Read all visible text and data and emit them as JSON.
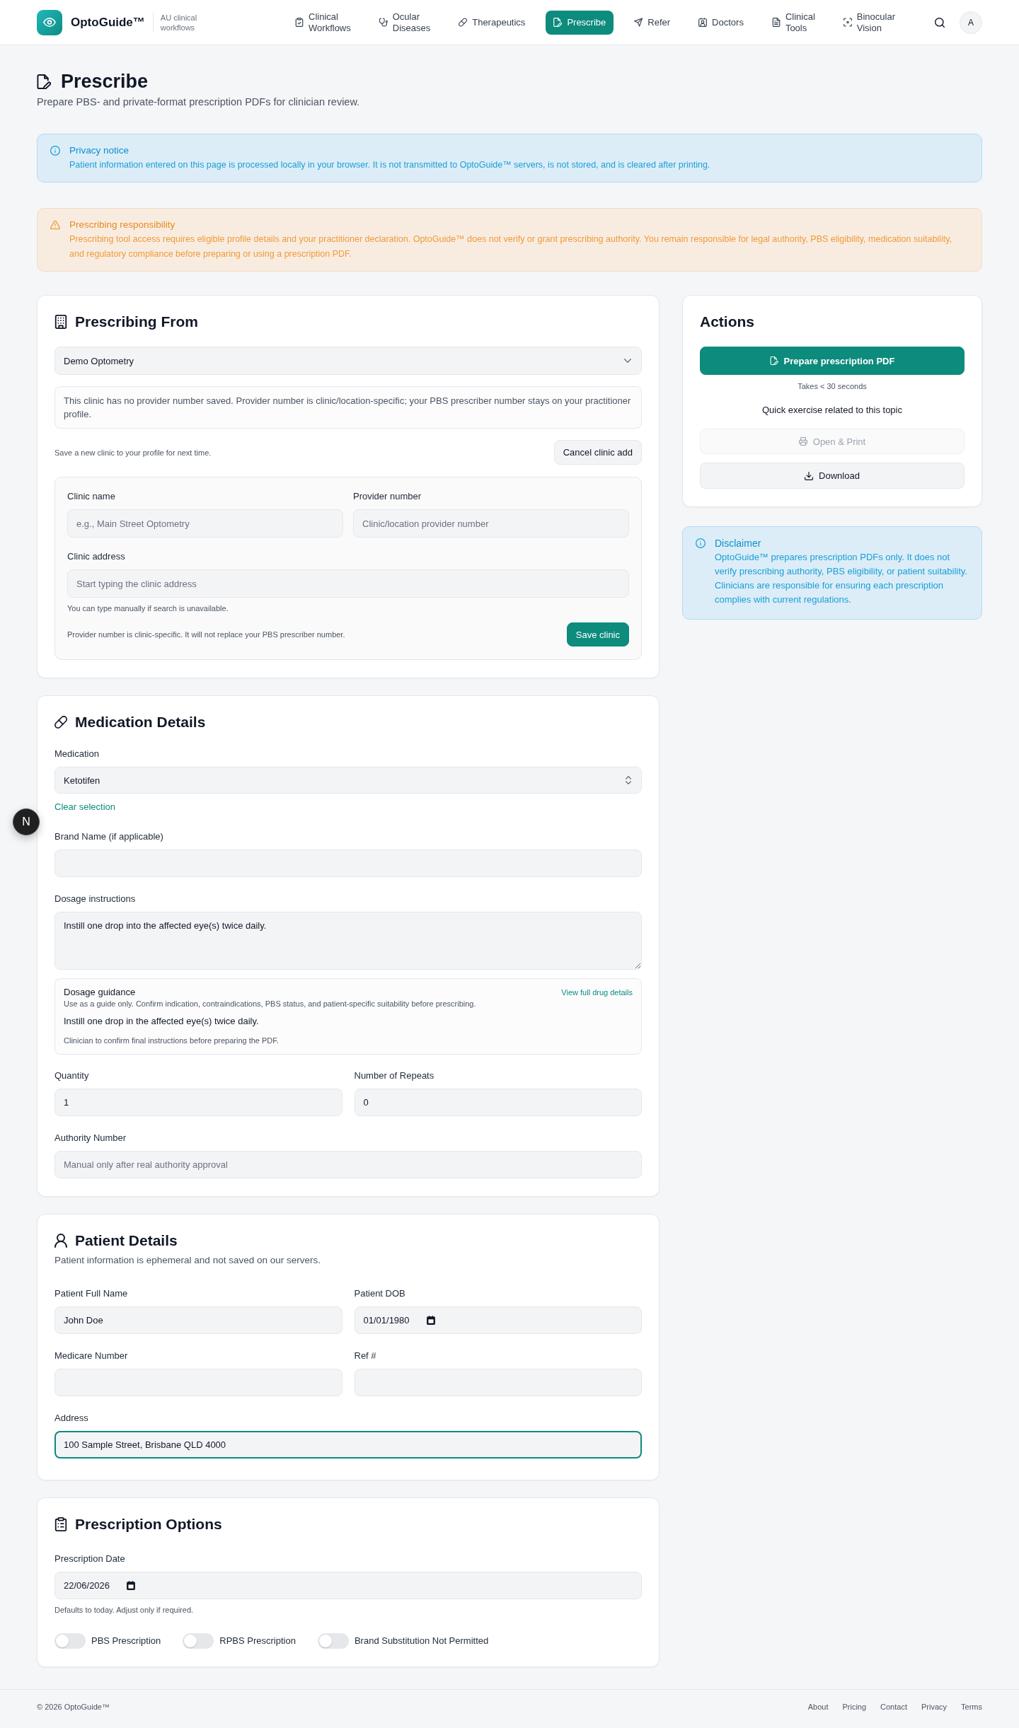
{
  "header": {
    "brand": {
      "name": "OptoGuide™",
      "tagline": "AU clinical workflows"
    },
    "nav": [
      {
        "label": "Clinical Workflows",
        "selected": false
      },
      {
        "label": "Ocular Diseases",
        "selected": false
      },
      {
        "label": "Therapeutics",
        "selected": false
      },
      {
        "label": "Prescribe",
        "selected": true
      },
      {
        "label": "Refer",
        "selected": false
      },
      {
        "label": "Doctors",
        "selected": false
      },
      {
        "label": "Clinical Tools",
        "selected": false
      },
      {
        "label": "Binocular Vision",
        "selected": false
      }
    ],
    "avatar": "A"
  },
  "page": {
    "title": "Prescribe",
    "subtitle": "Prepare PBS- and private-format prescription PDFs for clinician review."
  },
  "notices": [
    {
      "kind": "info",
      "title": "Privacy notice",
      "text": "Patient information entered on this page is processed locally in your browser. It is not transmitted to OptoGuide™ servers, is not stored, and is cleared after printing."
    },
    {
      "kind": "warning",
      "title": "Prescribing responsibility",
      "text": "Prescribing tool access requires eligible profile details and your practitioner declaration. OptoGuide™ does not verify or grant prescribing authority. You remain responsible for legal authority, PBS eligibility, medication suitability, and regulatory compliance before preparing or using a prescription PDF."
    }
  ],
  "prescribing_from": {
    "title": "Prescribing From",
    "clinic_select": {
      "value": "Demo Optometry"
    },
    "info": "This clinic has no provider number saved. Provider number is clinic/location-specific; your PBS prescriber number stays on your practitioner profile.",
    "save_hint": "Save a new clinic to your profile for next time.",
    "cancel_button": "Cancel clinic add",
    "new_clinic_form": {
      "fields": [
        {
          "label": "Clinic name",
          "placeholder": "e.g., Main Street Optometry"
        },
        {
          "label": "Provider number",
          "placeholder": "Clinic/location provider number"
        },
        {
          "label": "Clinic address",
          "placeholder": "Start typing the clinic address",
          "hint": "You can type manually if search is unavailable."
        }
      ],
      "note": "Provider number is clinic-specific. It will not replace your PBS prescriber number.",
      "save_button": "Save clinic"
    }
  },
  "actions": {
    "title": "Actions",
    "primary_button": "Prepare prescription PDF",
    "time_note": "Takes < 30 seconds",
    "exercise_text": "Quick exercise related to this topic",
    "buttons": [
      {
        "label": "Open & Print",
        "disabled": true
      },
      {
        "label": "Download",
        "disabled": false
      }
    ]
  },
  "disclaimer": {
    "title": "Disclaimer",
    "text": "OptoGuide™ prepares prescription PDFs only. It does not verify prescribing authority, PBS eligibility, or patient suitability. Clinicians are responsible for ensuring each prescription complies with current regulations."
  },
  "medication_details": {
    "title": "Medication Details",
    "medication": {
      "label": "Medication",
      "value": "Ketotifen"
    },
    "clear_link": "Clear selection",
    "brand_name": {
      "label": "Brand Name (if applicable)"
    },
    "dosage_instructions": {
      "label": "Dosage instructions",
      "value": "Instill one drop into the affected eye(s) twice daily."
    },
    "dosage_guidance": {
      "title": "Dosage guidance",
      "link": "View full drug details",
      "note": "Use as a guide only. Confirm indication, contraindications, PBS status, and patient-specific suitability before prescribing.",
      "text": "Instill one drop in the affected eye(s) twice daily.",
      "footnote": "Clinician to confirm final instructions before preparing the PDF."
    },
    "quantity": {
      "label": "Quantity",
      "value": "1"
    },
    "repeats": {
      "label": "Number of Repeats",
      "value": "0"
    },
    "authority_number": {
      "label": "Authority Number",
      "placeholder": "Manual only after real authority approval"
    }
  },
  "patient_details": {
    "title": "Patient Details",
    "subtitle": "Patient information is ephemeral and not saved on our servers.",
    "fields": [
      {
        "label": "Patient Full Name",
        "kind": "text",
        "value": "John Doe",
        "focused": false
      },
      {
        "label": "Patient DOB",
        "kind": "date",
        "value": "01/01/1980",
        "focused": false
      },
      {
        "label": "Medicare Number",
        "kind": "text",
        "focused": false
      },
      {
        "label": "Ref #",
        "kind": "text",
        "focused": false
      },
      {
        "label": "Address",
        "kind": "text",
        "value": "100 Sample Street, Brisbane QLD 4000",
        "focused": true
      }
    ]
  },
  "prescription_options": {
    "title": "Prescription Options",
    "date": {
      "label": "Prescription Date",
      "value": "22/06/2026",
      "hint": "Defaults to today. Adjust only if required."
    },
    "toggles": [
      {
        "label": "PBS Prescription",
        "on": false
      },
      {
        "label": "RPBS Prescription",
        "on": false
      },
      {
        "label": "Brand Substitution Not Permitted",
        "on": false
      }
    ]
  },
  "dev_indicator": {
    "label": "N"
  },
  "footer": {
    "copyright": "© 2026 OptoGuide™",
    "links": [
      "About",
      "Pricing",
      "Contact",
      "Privacy",
      "Terms"
    ]
  }
}
